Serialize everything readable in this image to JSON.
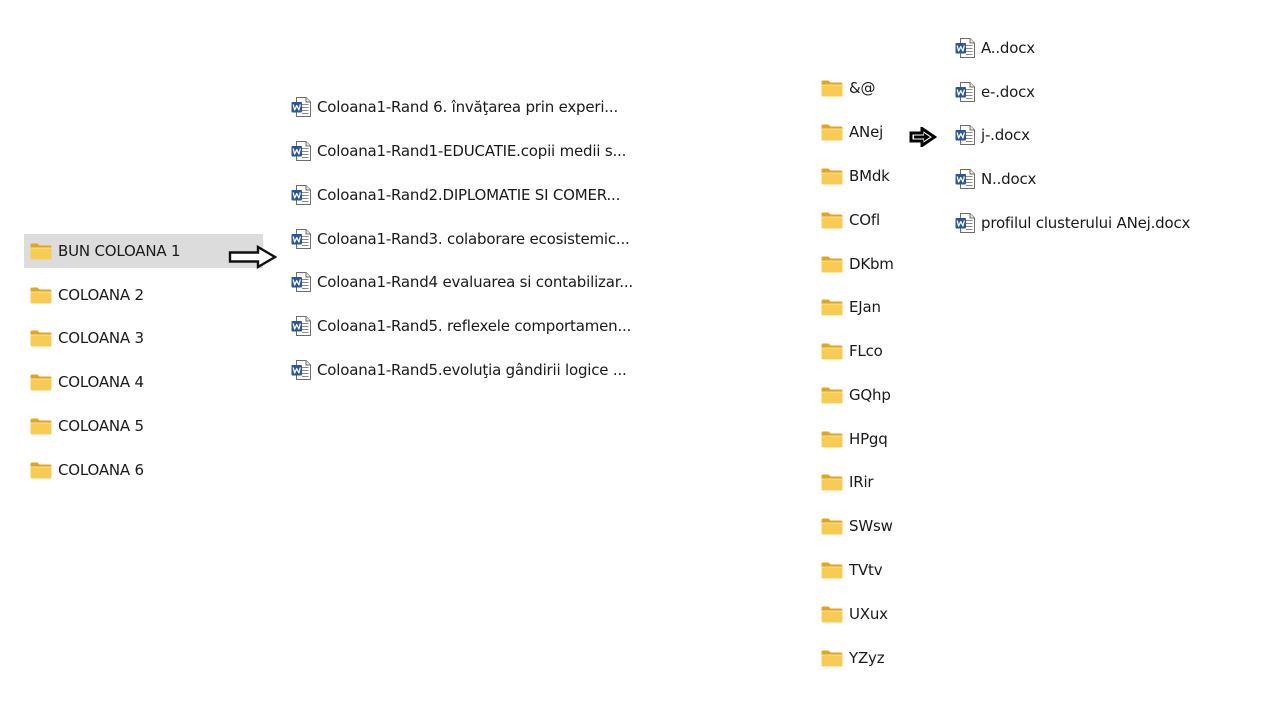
{
  "column1": {
    "folders": [
      {
        "label": "BUN COLOANA 1",
        "selected": true,
        "icon": "folder-icon"
      },
      {
        "label": "COLOANA 2",
        "selected": false,
        "icon": "folder-icon"
      },
      {
        "label": "COLOANA 3",
        "selected": false,
        "icon": "folder-icon"
      },
      {
        "label": "COLOANA 4",
        "selected": false,
        "icon": "folder-icon"
      },
      {
        "label": "COLOANA 5",
        "selected": false,
        "icon": "folder-icon"
      },
      {
        "label": "COLOANA 6",
        "selected": false,
        "icon": "folder-icon"
      }
    ]
  },
  "column2": {
    "files": [
      {
        "label": "Coloana1-Rand 6.  învăţarea prin experi...",
        "icon": "word-document-icon"
      },
      {
        "label": "Coloana1-Rand1-EDUCATIE.copii medii s...",
        "icon": "word-document-icon"
      },
      {
        "label": "Coloana1-Rand2.DIPLOMATIE SI COMER...",
        "icon": "word-document-icon"
      },
      {
        "label": "Coloana1-Rand3. colaborare ecosistemic...",
        "icon": "word-document-icon"
      },
      {
        "label": "Coloana1-Rand4 evaluarea si contabilizar...",
        "icon": "word-document-icon"
      },
      {
        "label": "Coloana1-Rand5. reflexele comportamen...",
        "icon": "word-document-icon"
      },
      {
        "label": "Coloana1-Rand5.evoluţia gândirii logice ...",
        "icon": "word-document-icon"
      }
    ]
  },
  "column3": {
    "folders": [
      {
        "label": "&@",
        "icon": "folder-icon"
      },
      {
        "label": "ANej",
        "icon": "folder-icon"
      },
      {
        "label": "BMdk",
        "icon": "folder-icon"
      },
      {
        "label": "COfl",
        "icon": "folder-icon"
      },
      {
        "label": "DKbm",
        "icon": "folder-icon"
      },
      {
        "label": "EJan",
        "icon": "folder-icon"
      },
      {
        "label": "FLco",
        "icon": "folder-icon"
      },
      {
        "label": "GQhp",
        "icon": "folder-icon"
      },
      {
        "label": "HPgq",
        "icon": "folder-icon"
      },
      {
        "label": "IRir",
        "icon": "folder-icon"
      },
      {
        "label": "SWsw",
        "icon": "folder-icon"
      },
      {
        "label": "TVtv",
        "icon": "folder-icon"
      },
      {
        "label": "UXux",
        "icon": "folder-icon"
      },
      {
        "label": "YZyz",
        "icon": "folder-icon"
      }
    ]
  },
  "column4": {
    "files": [
      {
        "label": "A..docx",
        "icon": "word-document-icon"
      },
      {
        "label": "e-.docx",
        "icon": "word-document-icon"
      },
      {
        "label": "j-.docx",
        "icon": "word-document-icon"
      },
      {
        "label": "N..docx",
        "icon": "word-document-icon"
      },
      {
        "label": "profilul clusterului ANej.docx",
        "icon": "word-document-icon"
      }
    ]
  },
  "arrows": [
    {
      "name": "outline-arrow-icon",
      "style": "outline"
    },
    {
      "name": "solid-arrow-icon",
      "style": "solid"
    }
  ],
  "colors": {
    "selection": "#dcdcdc",
    "folder": "#f2c24b",
    "word": "#2b579a",
    "text": "#1a1a1a"
  }
}
